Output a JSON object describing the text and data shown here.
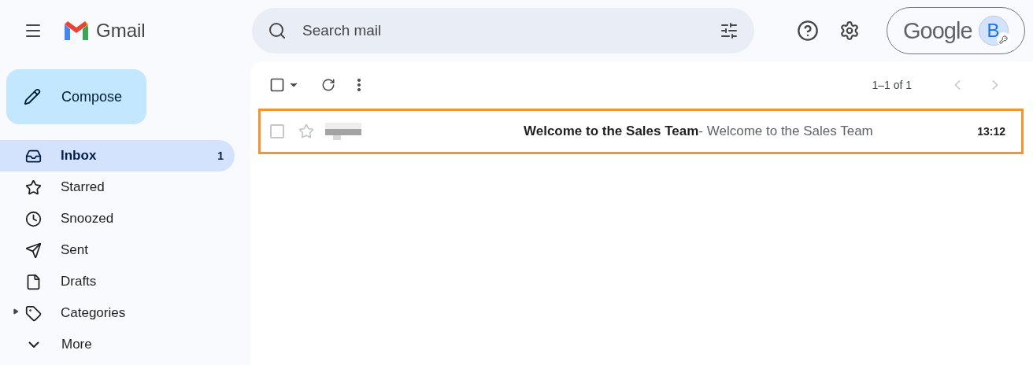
{
  "app": {
    "name": "Gmail"
  },
  "search": {
    "placeholder": "Search mail"
  },
  "account": {
    "brand": "Google",
    "avatar_initial": "B"
  },
  "compose": {
    "label": "Compose"
  },
  "sidebar": {
    "items": [
      {
        "kind": "inbox",
        "label": "Inbox",
        "count": "1",
        "selected": true
      },
      {
        "kind": "starred",
        "label": "Starred",
        "selected": false
      },
      {
        "kind": "snoozed",
        "label": "Snoozed",
        "selected": false
      },
      {
        "kind": "sent",
        "label": "Sent",
        "selected": false
      },
      {
        "kind": "drafts",
        "label": "Drafts",
        "selected": false
      },
      {
        "kind": "categories",
        "label": "Categories",
        "selected": false,
        "expanded": false
      },
      {
        "kind": "more",
        "label": "More",
        "selected": false
      }
    ]
  },
  "toolbar": {
    "pagination": "1–1 of 1"
  },
  "messages": [
    {
      "subject": "Welcome to the Sales Team",
      "snippet": " - Welcome to the Sales Team",
      "time": "13:12",
      "unread": true,
      "checked": false,
      "starred": false,
      "highlighted": true
    }
  ]
}
